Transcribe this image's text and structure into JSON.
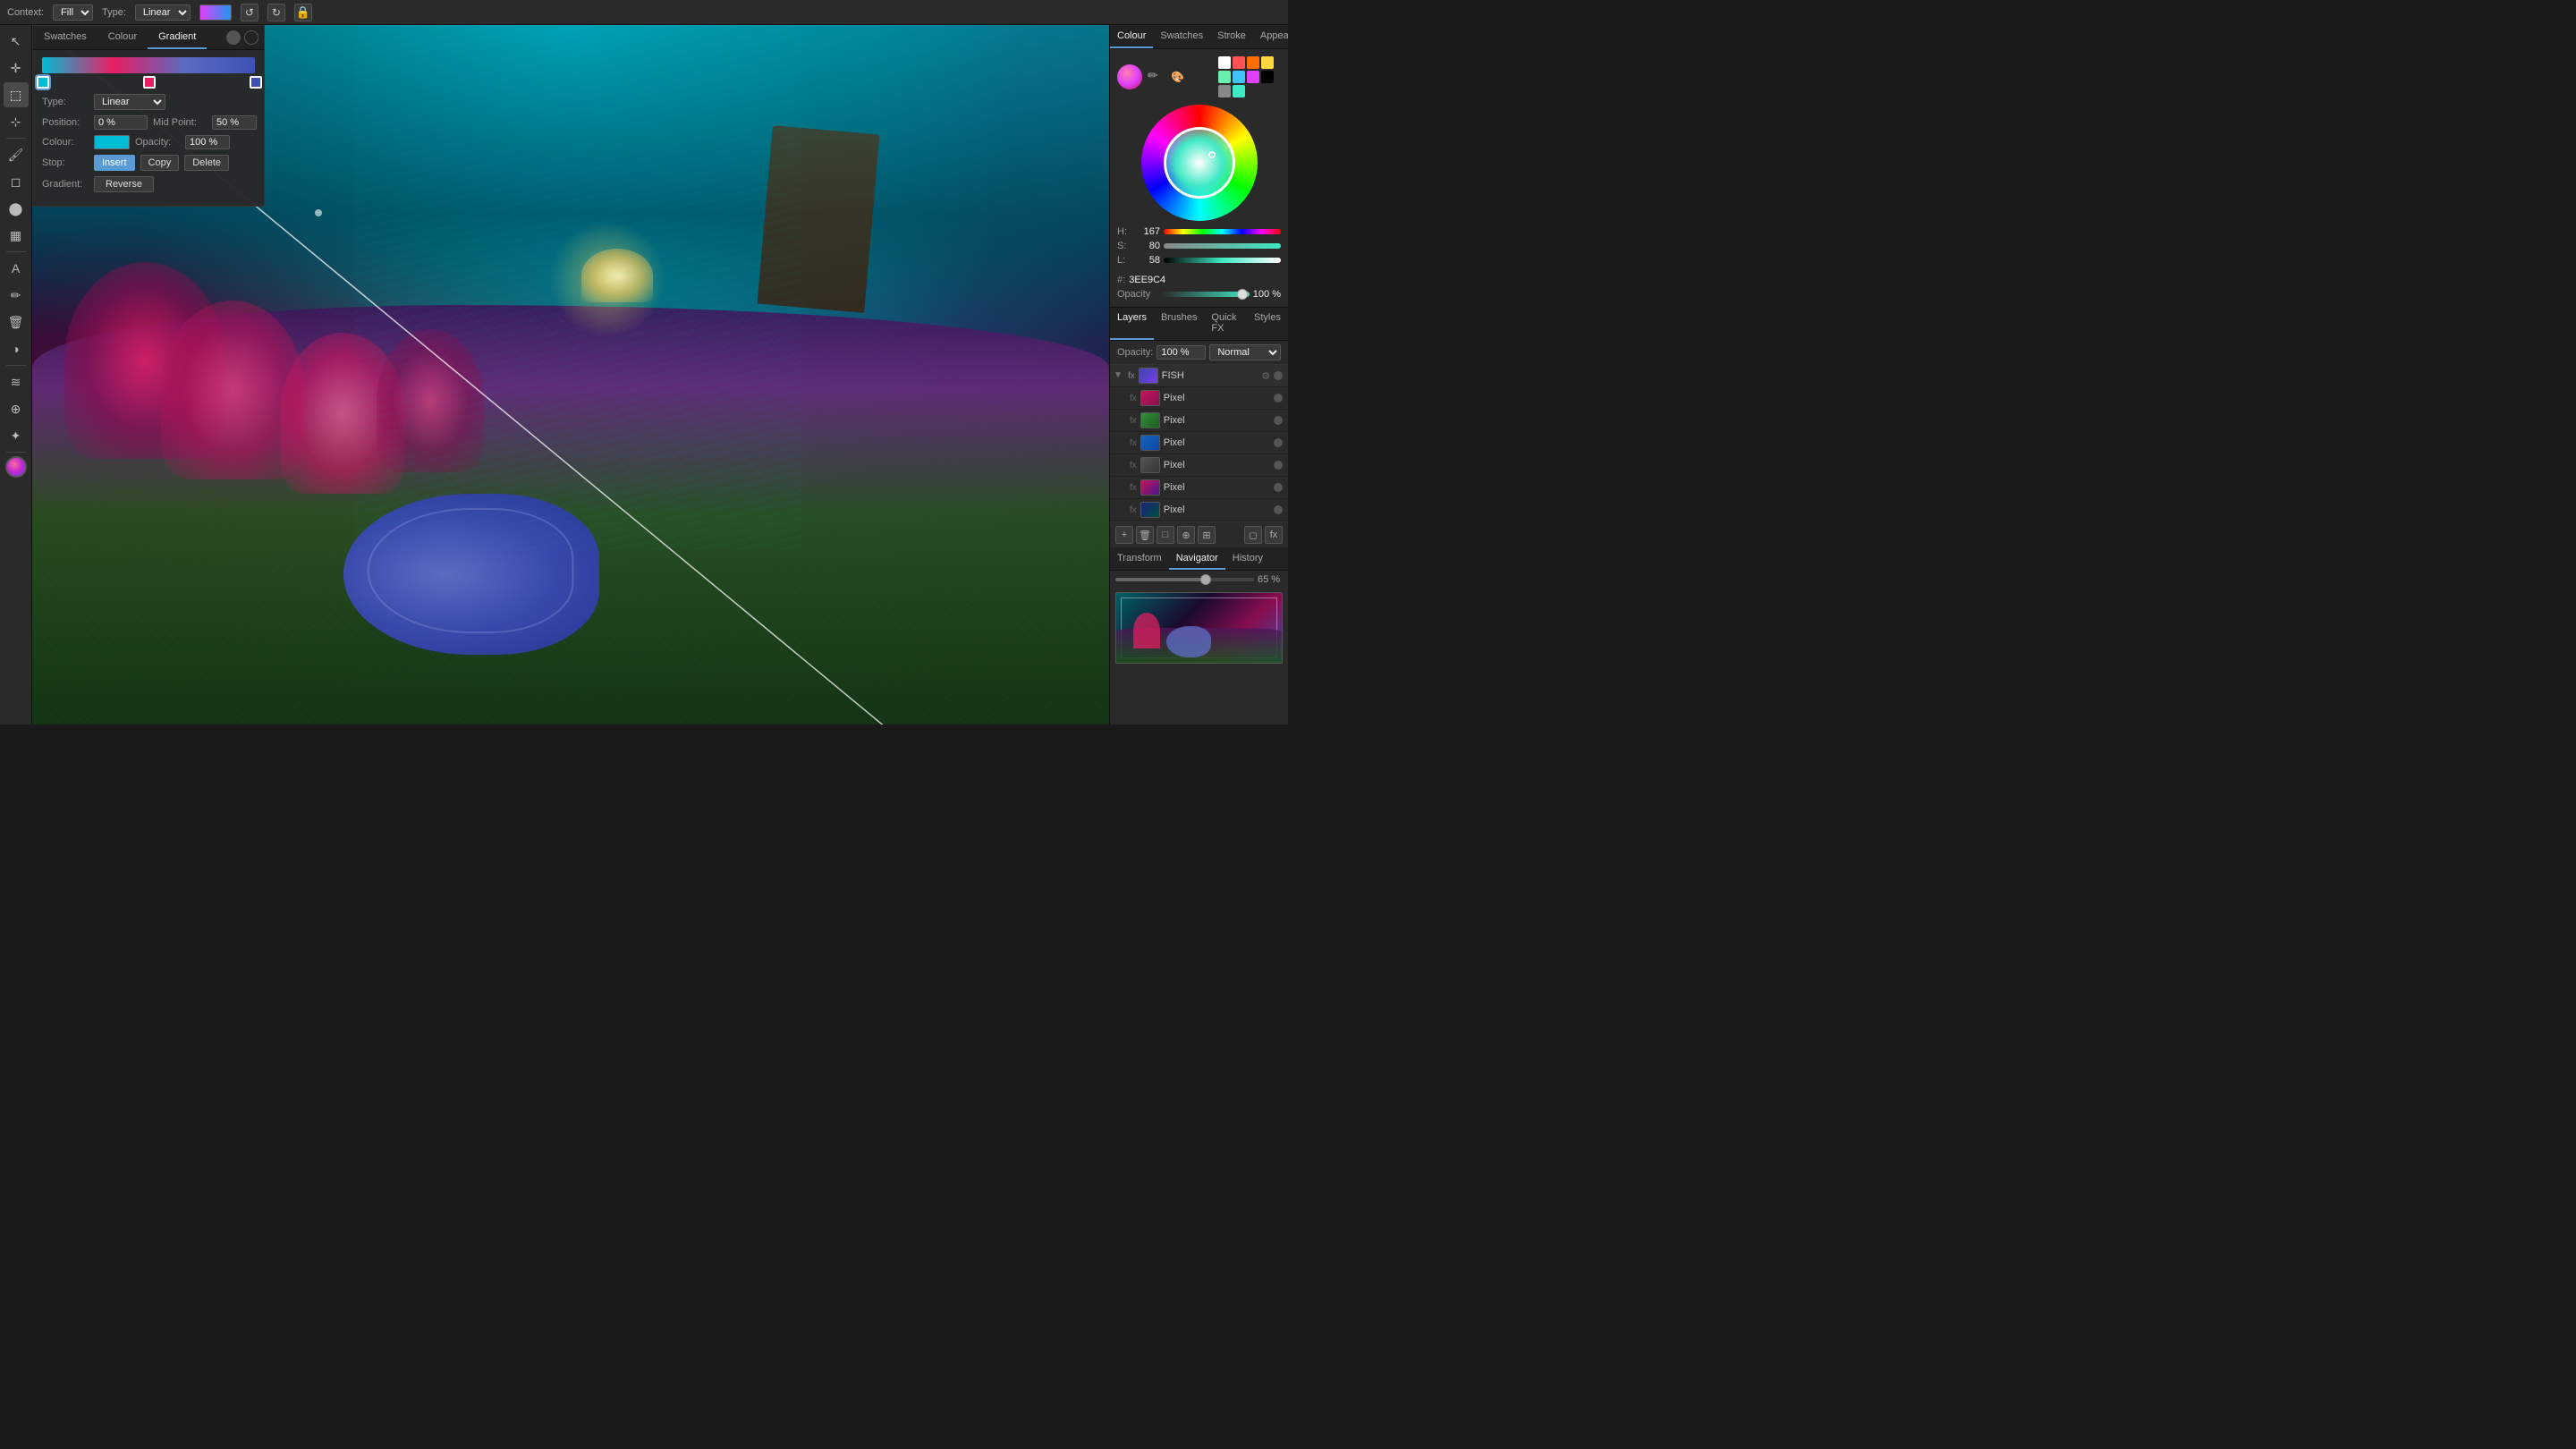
{
  "topbar": {
    "context_label": "Context:",
    "context_value": "Fill",
    "type_label": "Type:",
    "type_value": "Linear"
  },
  "gradient_panel": {
    "tabs": [
      "Swatches",
      "Colour",
      "Gradient"
    ],
    "active_tab": "Gradient",
    "type_label": "Type:",
    "type_value": "Linear",
    "position_label": "Position:",
    "position_value": "0 %",
    "mid_point_label": "Mid Point:",
    "mid_point_value": "50 %",
    "colour_label": "Colour:",
    "opacity_label": "Opacity:",
    "opacity_value": "100 %",
    "stop_label": "Stop:",
    "stop_insert": "Insert",
    "stop_copy": "Copy",
    "stop_delete": "Delete",
    "gradient_label": "Gradient:",
    "gradient_reverse": "Reverse"
  },
  "right_panel": {
    "color_tabs": [
      "Colour",
      "Swatches",
      "Stroke",
      "Appearance"
    ],
    "active_tab": "Colour",
    "h_label": "H:",
    "h_value": "167",
    "s_label": "S:",
    "s_value": "80",
    "l_label": "L:",
    "l_value": "58",
    "hex_label": "#:",
    "hex_value": "3EE9C4",
    "opacity_label": "Opacity",
    "opacity_value": "100 %"
  },
  "layers_panel": {
    "tabs": [
      "Layers",
      "Brushes",
      "Quick FX",
      "Styles"
    ],
    "active_tab": "Layers",
    "opacity_label": "Opacity:",
    "opacity_value": "100 %",
    "blend_mode": "Normal",
    "group_name": "FISH",
    "layers": [
      {
        "name": "Pixel",
        "type": "pixel"
      },
      {
        "name": "Pixel",
        "type": "pixel"
      },
      {
        "name": "Pixel",
        "type": "pixel"
      },
      {
        "name": "Pixel",
        "type": "pixel"
      },
      {
        "name": "Pixel",
        "type": "pixel"
      },
      {
        "name": "Pixel",
        "type": "pixel"
      }
    ]
  },
  "nav_panel": {
    "tabs": [
      "Transform",
      "Navigator",
      "History"
    ],
    "active_tab": "Navigator",
    "zoom_value": "65 %"
  },
  "tools": {
    "items": [
      "pointer",
      "move",
      "select",
      "crop",
      "brush",
      "eraser",
      "fill",
      "gradient",
      "text",
      "eyedropper",
      "paint-bucket",
      "burn",
      "dodge",
      "smudge",
      "clone"
    ]
  }
}
